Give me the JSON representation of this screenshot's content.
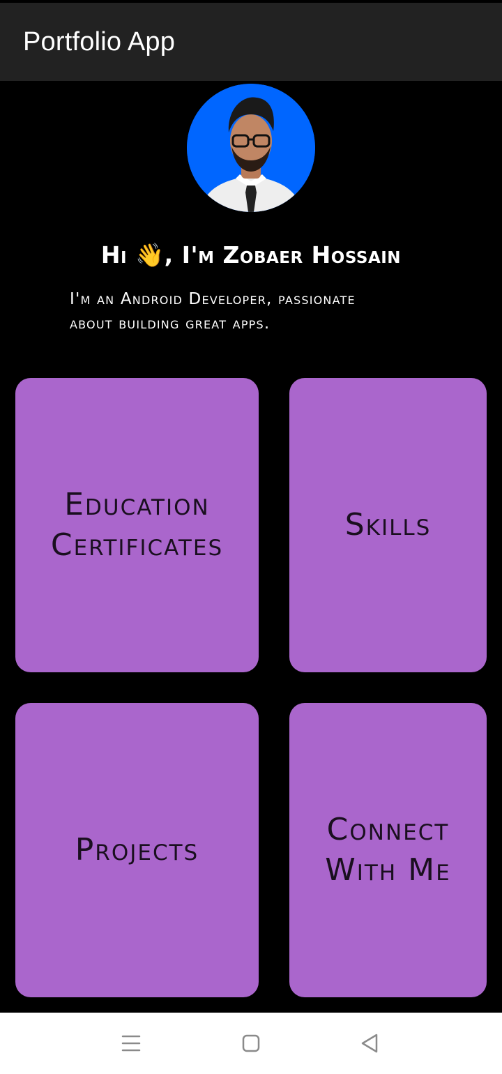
{
  "app_bar": {
    "title": "Portfolio App"
  },
  "profile": {
    "greeting": "Hi 👋, I'm Zobaer Hossain",
    "tagline_line1": "I'm an Android Developer, passionate",
    "tagline_line2": "about building great apps."
  },
  "cards": {
    "education_line1": "Education",
    "education_line2": "Certificates",
    "skills": "Skills",
    "projects": "Projects",
    "connect_line1": "Connect",
    "connect_line2": "With Me"
  },
  "nav": {
    "menu_icon": "menu-lines-icon",
    "home_icon": "square-home-icon",
    "back_icon": "triangle-back-icon"
  },
  "colors": {
    "background": "#000000",
    "app_bar": "#222222",
    "card": "#aa66cc",
    "avatar_bg": "#0066ff",
    "nav_bar": "#ffffff",
    "nav_icon": "#8a8a8a"
  }
}
